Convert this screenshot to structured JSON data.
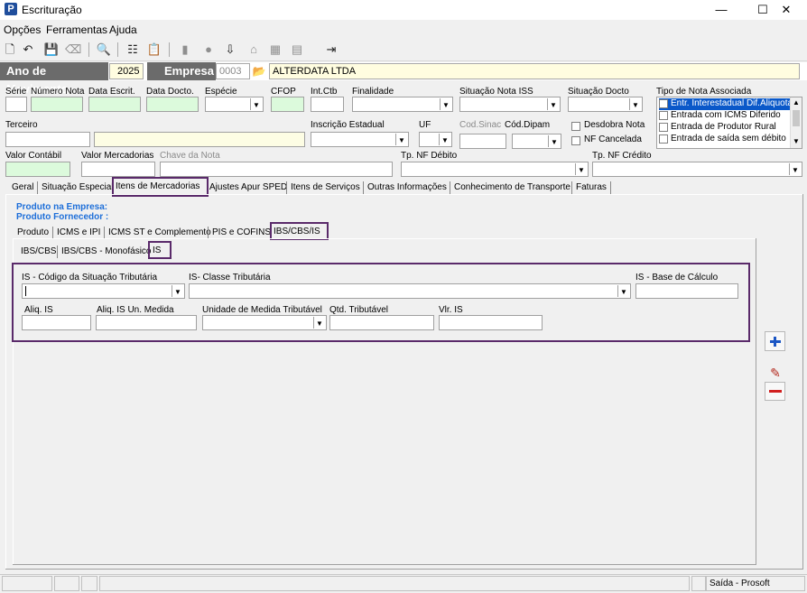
{
  "window": {
    "title": "Escrituração",
    "app_icon": "P",
    "minimize": "—",
    "maximize": "☐",
    "close": "✕"
  },
  "menu": [
    "Opções",
    "Ferramentas",
    "Ajuda"
  ],
  "header": {
    "year_label": "Ano de Movimento",
    "year_value": "2025",
    "company_label": "Empresa",
    "company_code": "0003",
    "company_name": "ALTERDATA LTDA"
  },
  "fields_row1": {
    "serie": "Série",
    "numero_nota": "Número Nota",
    "data_escrit": "Data Escrit.",
    "data_docto": "Data Docto.",
    "especie": "Espécie",
    "cfop": "CFOP",
    "int_ctb": "Int.Ctb",
    "finalidade": "Finalidade",
    "situacao_nota_iss": "Situação Nota ISS",
    "situacao_docto": "Situação Docto",
    "tipo_nota_associada": "Tipo de Nota Associada"
  },
  "tipo_nota_list": [
    "Entr. Interestadual Dif.Aliquota",
    "Entrada com ICMS Diferido",
    "Entrada de Produtor Rural",
    "Entrada de saída sem débito"
  ],
  "fields_row2": {
    "terceiro": "Terceiro",
    "inscricao_estadual": "Inscrição Estadual",
    "uf": "UF",
    "cod_sinac": "Cod.Sinac",
    "cod_dipam": "Cód.Dipam",
    "desdobra_nota": "Desdobra Nota",
    "nf_cancelada": "NF Cancelada"
  },
  "fields_row3": {
    "valor_contabil": "Valor Contábil",
    "valor_mercadorias": "Valor Mercadorias",
    "chave_nota": "Chave da Nota",
    "tp_nf_debito": "Tp. NF Débito",
    "tp_nf_credito": "Tp. NF Crédito"
  },
  "main_tabs": [
    "Geral",
    "Situação Especial",
    "Itens de Mercadorias",
    "Ajustes Apur SPED",
    "Itens de Serviços",
    "Outras Informações",
    "Conhecimento de Transporte",
    "Faturas"
  ],
  "produto": {
    "empresa_label": "Produto na Empresa:",
    "fornecedor_label": "Produto Fornecedor :"
  },
  "sub_tabs": [
    "Produto",
    "ICMS e IPI",
    "ICMS ST e Complemento",
    "PIS e COFINS",
    "IBS/CBS/IS"
  ],
  "sub_sub_tabs": [
    "IBS/CBS",
    "IBS/CBS - Monofásico",
    "IS"
  ],
  "is_fields": {
    "cst_label": "IS - Código da Situação Tributária",
    "classe_label": "IS- Classe Tributária",
    "base_label": "IS - Base de Cálculo",
    "aliq_label": "Aliq. IS",
    "aliq_un_label": "Aliq. IS Un. Medida",
    "unidade_label": "Unidade de Medida Tributável",
    "qtd_label": "Qtd. Tributável",
    "vlr_label": "Vlr. IS"
  },
  "status": {
    "text": "Saída - Prosoft"
  },
  "colors": {
    "accent_highlight": "#5a2a6a",
    "blue_text": "#1e6fd9",
    "green_field": "#dcfadc",
    "yellow_field": "#fffde0"
  }
}
